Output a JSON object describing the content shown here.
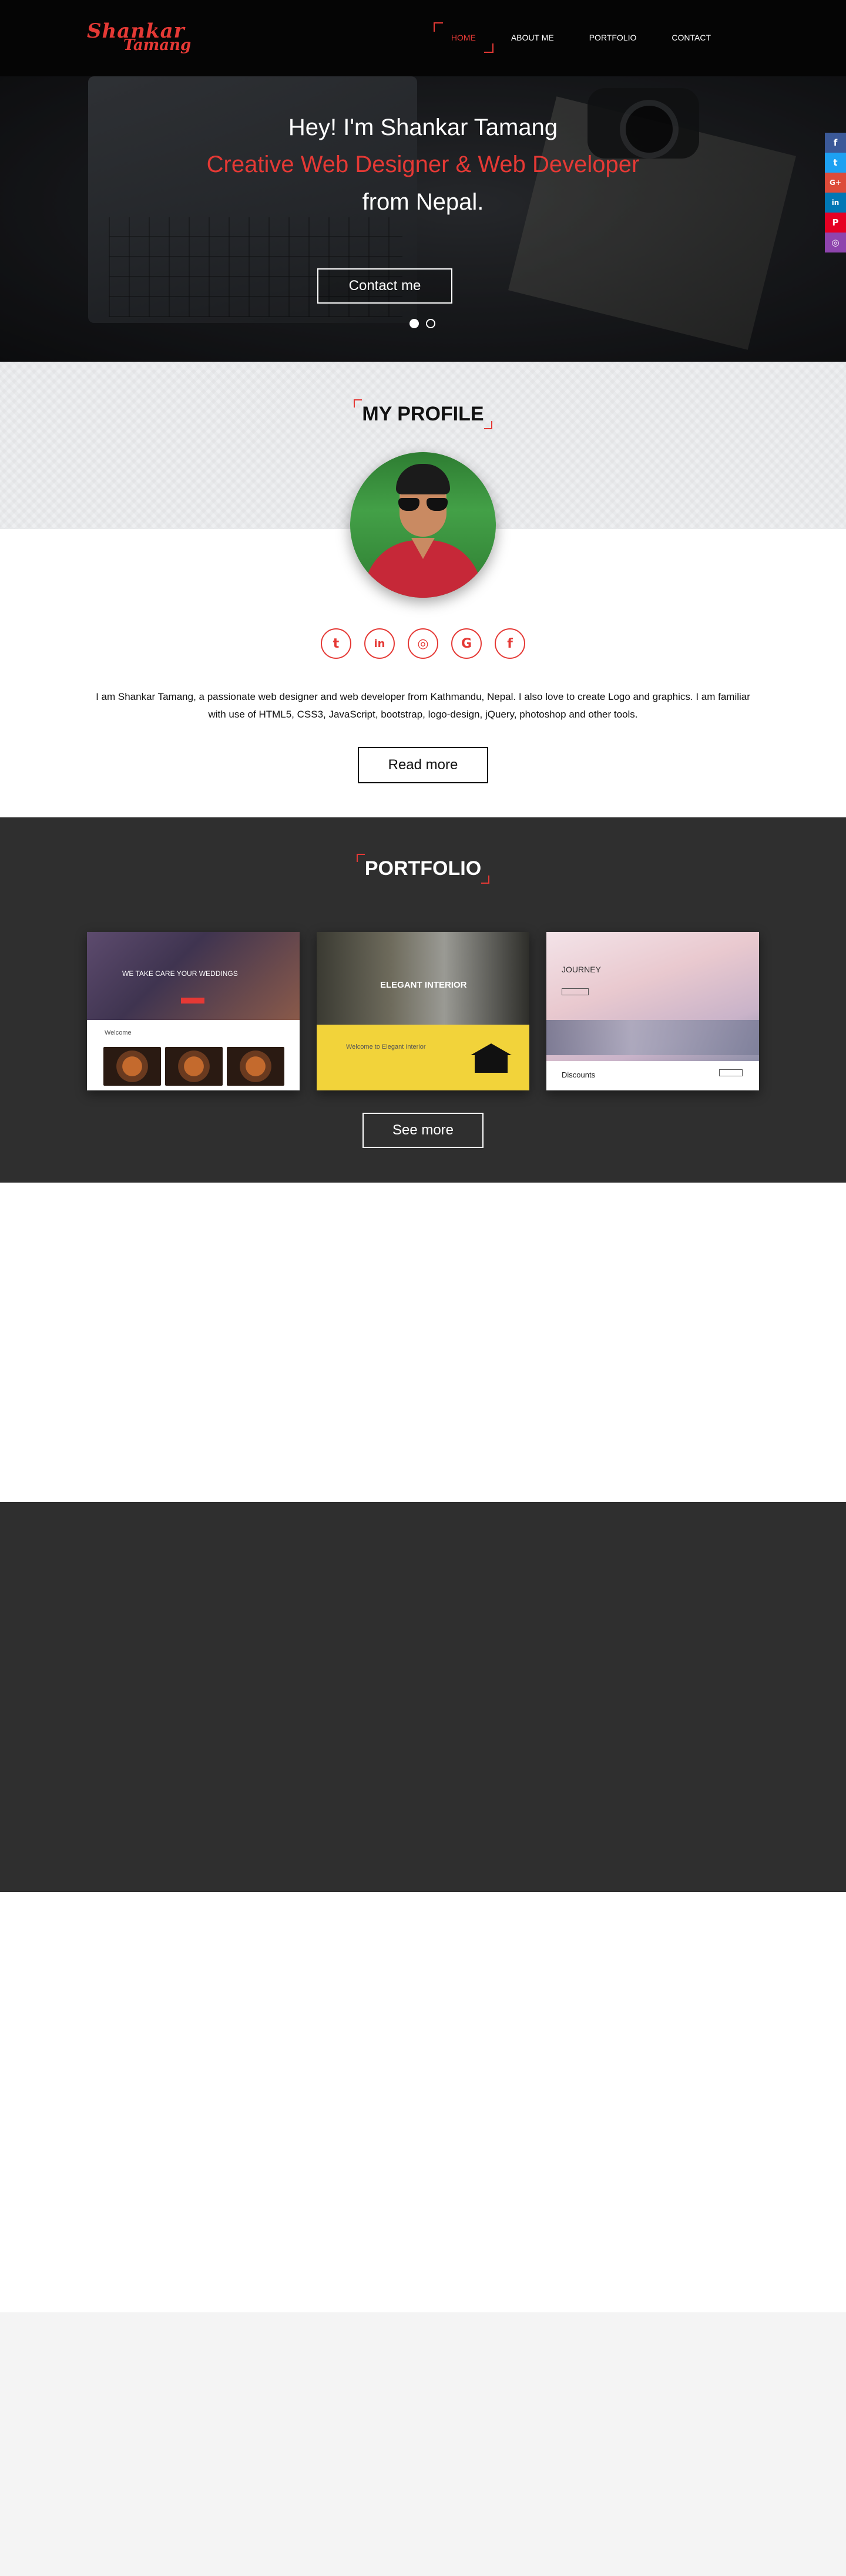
{
  "brand": {
    "line1": "Shankar",
    "line2": "Tamang",
    "color": "#e53935"
  },
  "nav": {
    "items": [
      {
        "label": "HOME",
        "active": true
      },
      {
        "label": "ABOUT ME",
        "active": false
      },
      {
        "label": "PORTFOLIO",
        "active": false
      },
      {
        "label": "CONTACT",
        "active": false
      }
    ]
  },
  "hero": {
    "line1": "Hey! I'm Shankar Tamang",
    "line2": "Creative Web Designer & Web Developer",
    "line3": "from Nepal.",
    "button": "Contact me",
    "slides": 2,
    "active_slide": 1
  },
  "side_social": [
    {
      "icon": "facebook-icon",
      "glyph": "f",
      "color": "#3b5998"
    },
    {
      "icon": "twitter-icon",
      "glyph": "t",
      "color": "#1da1f2"
    },
    {
      "icon": "google-plus-icon",
      "glyph": "G+",
      "color": "#dd4b39"
    },
    {
      "icon": "linkedin-icon",
      "glyph": "in",
      "color": "#0077b5"
    },
    {
      "icon": "pinterest-icon",
      "glyph": "P",
      "color": "#e60023"
    },
    {
      "icon": "instagram-icon",
      "glyph": "◎",
      "color": "#8e44ad"
    }
  ],
  "profile": {
    "title": "MY PROFILE",
    "social": [
      {
        "icon": "twitter-icon",
        "glyph": "t"
      },
      {
        "icon": "linkedin-icon",
        "glyph": "in"
      },
      {
        "icon": "instagram-icon",
        "glyph": "◎"
      },
      {
        "icon": "google-icon",
        "glyph": "G"
      },
      {
        "icon": "facebook-icon",
        "glyph": "f"
      }
    ],
    "bio": "I am Shankar Tamang, a passionate web designer and web developer from Kathmandu, Nepal. I also love to create Logo and graphics. I am familiar with use of HTML5, CSS3, JavaScript, bootstrap, logo-design, jQuery, photoshop and other tools.",
    "button": "Read more"
  },
  "portfolio": {
    "title": "PORTFOLIO",
    "card1": {
      "headline": "WE TAKE CARE YOUR WEDDINGS",
      "sub": "Welcome"
    },
    "card2": {
      "headline": "ELEGANT INTERIOR",
      "sub": "Welcome to Elegant Interior"
    },
    "card3": {
      "headline": "JOURNEY",
      "footer": "Discounts"
    },
    "button": "See more"
  },
  "colors": {
    "accent": "#e53935",
    "dark": "#2f2f2f",
    "nav": "#050505"
  }
}
